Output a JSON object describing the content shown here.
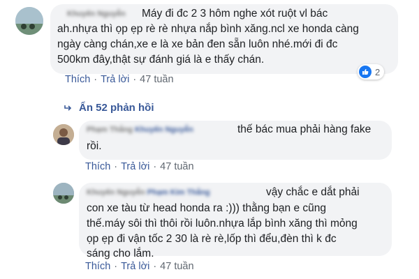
{
  "comment": {
    "author": "Khuyến Nguyễn",
    "lines": [
      "Máy đi đc 2 3 hôm nghe xót ruột vl bác",
      "ah.nhựa thì ọp ẹp rè rè nhựa nắp bình xăng.ncl xe honda càng",
      "ngày càng chán,xe e là xe bản đen sẵn luôn nhé.mới đi đc",
      "500km đây,thật sự đánh giá là e thấy chán."
    ],
    "like_label": "Thích",
    "reply_label": "Trả lời",
    "time": "47 tuần",
    "reaction_count": "2"
  },
  "hidden_replies_label": "Ẩn 52 phản hồi",
  "replies": [
    {
      "author": "Phạm Thắng",
      "tag": "Khuyến Nguyễn",
      "lines": [
        "thế bác mua phải hàng fake",
        "rồi."
      ],
      "like_label": "Thích",
      "reply_label": "Trả lời",
      "time": "47 tuần"
    },
    {
      "author": "Khuyến Nguyễn",
      "tag": "Phạm Kim Thắng",
      "lines": [
        "vậy chắc e dắt phải",
        "con xe tàu từ head honda ra :))) thằng bạn e cũng",
        "thế.máy sôi thì thôi rồi luôn.nhựa lắp bình xăng thì mỏng",
        "ọp ẹp đi vận tốc 2 30 là rè rè,lốp thì đểu,đèn thì k đc",
        "sáng cho lắm."
      ],
      "like_label": "Thích",
      "reply_label": "Trả lời",
      "time": "47 tuần"
    }
  ],
  "colors": {
    "link": "#385898",
    "bubble": "#f2f3f5",
    "like_blue": "#1877f2",
    "meta_gray": "#606770"
  }
}
